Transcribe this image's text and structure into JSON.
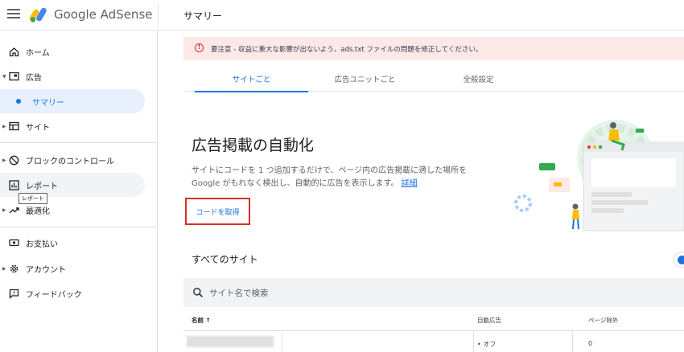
{
  "header": {
    "brand": "Google AdSense",
    "page_title": "サマリー"
  },
  "sidebar": {
    "items": [
      {
        "label": "ホーム"
      },
      {
        "label": "広告"
      },
      {
        "label": "サマリー"
      },
      {
        "label": "サイト"
      },
      {
        "label": "ブロックのコントロール"
      },
      {
        "label": "レポート"
      },
      {
        "label": "最適化"
      },
      {
        "label": "お支払い"
      },
      {
        "label": "アカウント"
      },
      {
        "label": "フィードバック"
      }
    ],
    "tooltip": "レポート"
  },
  "alert": {
    "text": "要注意 - 収益に重大な影響が出ないよう、ads.txt ファイルの問題を修正してください。"
  },
  "tabs": [
    "サイトごと",
    "広告ユニットごと",
    "全般設定"
  ],
  "auto_ads": {
    "title": "広告掲載の自動化",
    "desc_line1": "サイトにコードを 1 つ追加するだけで、ページ内の広告掲載に適した場所を",
    "desc_line2": "Google がもれなく検出し、自動的に広告を表示します。",
    "detail_link": "詳細",
    "get_code": "コードを取得"
  },
  "sites": {
    "heading": "すべてのサイト",
    "search_placeholder": "サイト名で検索",
    "columns": {
      "name": "名前 ↑",
      "auto_ads": "自動広告",
      "page_exclusions": "ページ除外"
    },
    "rows": [
      {
        "auto_ads": "• オフ",
        "page_exclusions": "0"
      }
    ]
  },
  "colors": {
    "accent": "#1a73e8",
    "alert_bg": "#fce8e6",
    "alert_icon": "#d93025",
    "highlight_border": "#d93025"
  }
}
